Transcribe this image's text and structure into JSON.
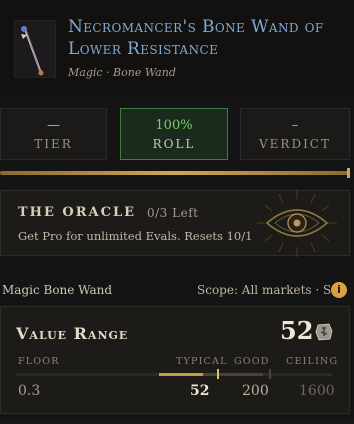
{
  "item": {
    "title": "Necromancer's Bone Wand of Lower Resistance",
    "subtitle": "Magic · Bone Wand",
    "icon": "bone-wand-icon"
  },
  "stats": [
    {
      "value": "—",
      "label": "TIER"
    },
    {
      "value": "100%",
      "label": "ROLL"
    },
    {
      "value": "–",
      "label": "VERDICT"
    }
  ],
  "oracle": {
    "title": "THE ORACLE",
    "count": "0/3 Left",
    "text": "Get Pro for unlimited Evals. Resets 10/1",
    "icon": "oracle-eye-icon"
  },
  "market": {
    "item_name": "Magic Bone Wand",
    "scope": "Scope: All markets · SC",
    "info_icon": "i"
  },
  "value_range": {
    "title": "Value Range",
    "value": "52",
    "currency_icon": "rune-icon",
    "labels": {
      "floor": "FLOOR",
      "typical": "TYPICAL",
      "good": "GOOD",
      "ceiling": "CEILING"
    },
    "floor": "0.3",
    "typical": "52",
    "good": "200",
    "ceiling": "1600"
  },
  "colors": {
    "accent_gold": "#d0a756",
    "title_blue": "#7fa9d6",
    "roll_green": "#7ccf6a",
    "info_orange": "#d9a23c"
  }
}
